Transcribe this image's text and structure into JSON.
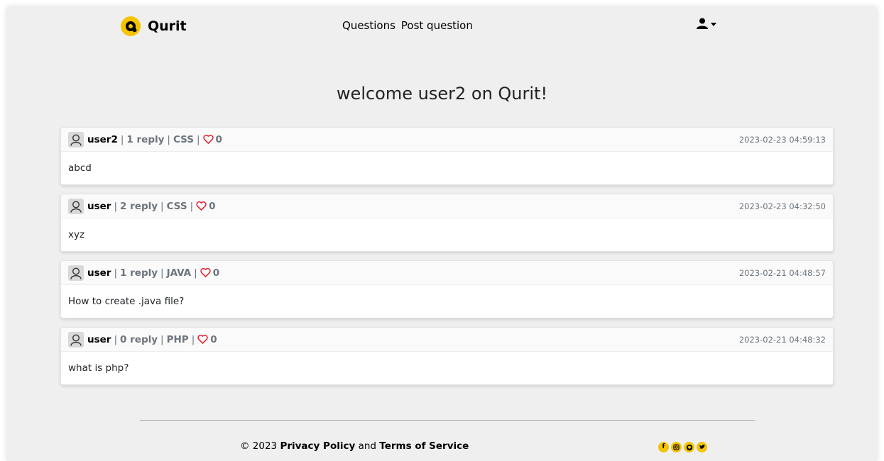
{
  "brand": {
    "name": "Qurit"
  },
  "nav": {
    "questions": "Questions",
    "post_question": "Post question"
  },
  "welcome": "welcome user2 on Qurit!",
  "posts": [
    {
      "author": "user2",
      "replies": "1 reply",
      "tag": "CSS",
      "likes": "0",
      "date": "2023-02-23 04:59:13",
      "body": "abcd"
    },
    {
      "author": "user",
      "replies": "2 reply",
      "tag": "CSS",
      "likes": "0",
      "date": "2023-02-23 04:32:50",
      "body": "xyz"
    },
    {
      "author": "user",
      "replies": "1 reply",
      "tag": "JAVA",
      "likes": "0",
      "date": "2023-02-21 04:48:57",
      "body": "How to create .java file?"
    },
    {
      "author": "user",
      "replies": "0 reply",
      "tag": "PHP",
      "likes": "0",
      "date": "2023-02-21 04:48:32",
      "body": "what is php?"
    }
  ],
  "footer": {
    "copyright": "© 2023",
    "privacy": "Privacy Policy",
    "and": "and",
    "terms": "Terms of Service"
  },
  "social_icons": [
    "facebook-icon",
    "instagram-icon",
    "github-icon",
    "twitter-icon"
  ],
  "colors": {
    "accent": "#f5c400",
    "heart": "#e0202f",
    "background": "#efefef"
  }
}
